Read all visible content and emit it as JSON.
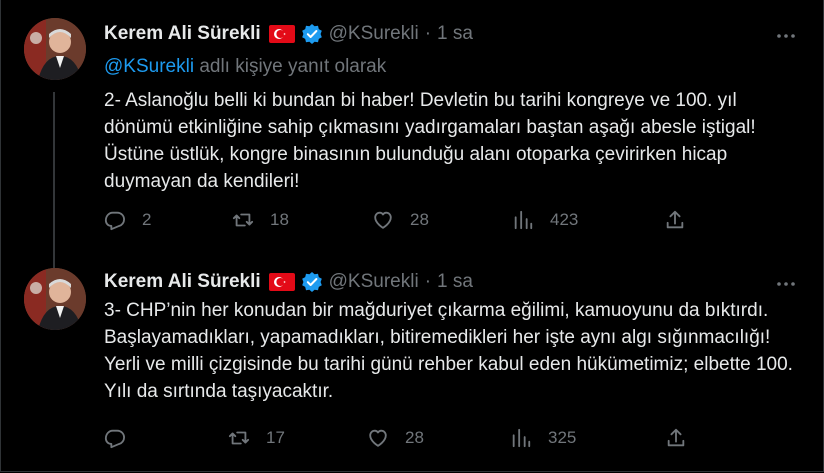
{
  "tweets": [
    {
      "author": "Kerem Ali Sürekli",
      "handle": "@KSurekli",
      "dot": "·",
      "time": "1 sa",
      "reply_mention": "@KSurekli",
      "reply_suffix": "adlı kişiye yanıt olarak",
      "text": "2- Aslanoğlu belli ki bundan bi haber! Devletin bu tarihi kongreye ve 100. yıl dönümü etkinliğine sahip çıkmasını yadırgamaları baştan aşağı abesle iştigal! Üstüne üstlük, kongre binasının bulunduğu alanı otoparka çevirirken hicap duymayan da kendileri!",
      "replies": "2",
      "retweets": "18",
      "likes": "28",
      "views": "423"
    },
    {
      "author": "Kerem Ali Sürekli",
      "handle": "@KSurekli",
      "dot": "·",
      "time": "1 sa",
      "text": "3- CHP’nin her konudan bir mağduriyet çıkarma eğilimi, kamuoyunu da bıktırdı. Başlayamadıkları, yapamadıkları, bitiremedikleri her işte aynı algı sığınmacılığı! Yerli ve milli çizgisinde bu tarihi günü rehber kabul eden hükümetimiz; elbette 100. Yılı da sırtında taşıyacaktır.",
      "replies": "",
      "retweets": "17",
      "likes": "28",
      "views": "325"
    }
  ],
  "icons": {
    "flag": "turkey-flag-icon",
    "verified": "verified-badge-icon",
    "more": "more-options-icon",
    "reply": "reply-icon",
    "retweet": "retweet-icon",
    "like": "heart-icon",
    "views": "views-chart-icon",
    "share": "share-icon"
  },
  "colors": {
    "background": "#000000",
    "text": "#e7e9ea",
    "secondary": "#71767b",
    "accent": "#1d9bf0",
    "flag_red": "#e30a17"
  }
}
